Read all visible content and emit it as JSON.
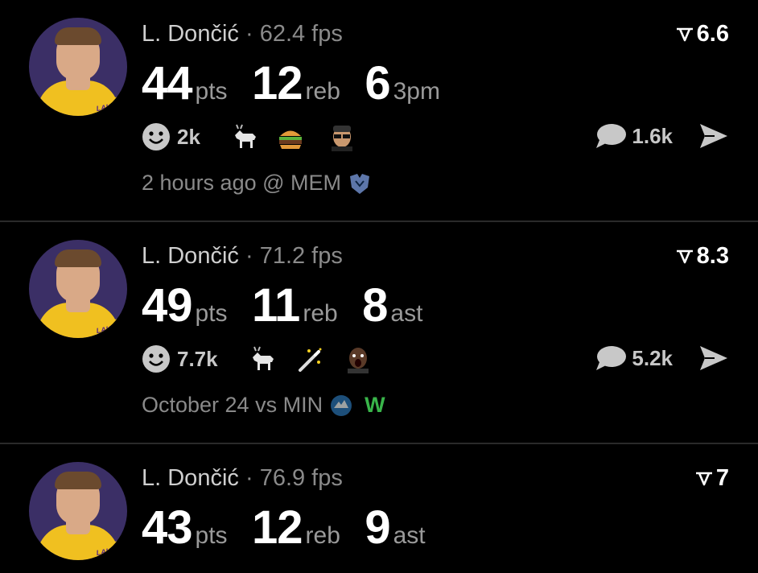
{
  "cards": [
    {
      "player": "L. Dončić",
      "separator": "·",
      "fps": "62.4 fps",
      "rating": "6.6",
      "stats": [
        {
          "num": "44",
          "unit": "pts"
        },
        {
          "num": "12",
          "unit": "reb"
        },
        {
          "num": "6",
          "unit": "3pm"
        }
      ],
      "reaction_count": "2k",
      "emoji_icons": [
        "goat-emoji",
        "burger-emoji",
        "sunglasses-face-emoji"
      ],
      "comment_count": "1.6k",
      "meta_text": "2 hours ago @ MEM",
      "team_logo": "grizzlies-logo-icon",
      "result": ""
    },
    {
      "player": "L. Dončić",
      "separator": "·",
      "fps": "71.2 fps",
      "rating": "8.3",
      "stats": [
        {
          "num": "49",
          "unit": "pts"
        },
        {
          "num": "11",
          "unit": "reb"
        },
        {
          "num": "8",
          "unit": "ast"
        }
      ],
      "reaction_count": "7.7k",
      "emoji_icons": [
        "goat-emoji",
        "magic-wand-emoji",
        "shocked-face-emoji"
      ],
      "comment_count": "5.2k",
      "meta_text": "October 24 vs MIN",
      "team_logo": "timberwolves-logo-icon",
      "result": "W"
    },
    {
      "player": "L. Dončić",
      "separator": "·",
      "fps": "76.9 fps",
      "rating": "7",
      "stats": [
        {
          "num": "43",
          "unit": "pts"
        },
        {
          "num": "12",
          "unit": "reb"
        },
        {
          "num": "9",
          "unit": "ast"
        }
      ]
    }
  ],
  "team_badge": "LAKERS",
  "colors": {
    "win": "#39b54a",
    "jersey": "#f0c020",
    "muted": "#8a8a8a"
  }
}
